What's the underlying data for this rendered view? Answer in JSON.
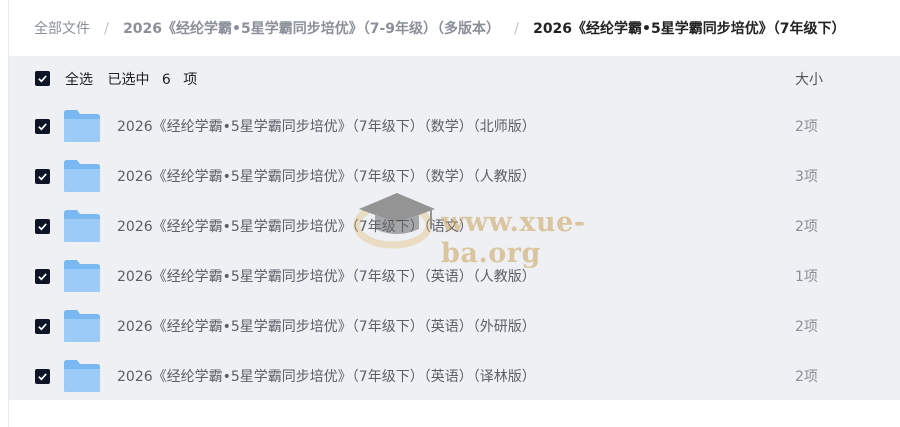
{
  "breadcrumb": {
    "root": "全部文件",
    "parent": "2026《经纶学霸•5星学霸同步培优》（7-9年级）（多版本）",
    "current": "2026《经纶学霸•5星学霸同步培优》（7年级下）"
  },
  "list": {
    "select_all_label": "全选",
    "selected_prefix": "已选中",
    "selected_count": "6",
    "selected_suffix": "项",
    "size_header": "大小",
    "items": [
      {
        "name": "2026《经纶学霸•5星学霸同步培优》（7年级下）（数学）（北师版）",
        "count": "2项"
      },
      {
        "name": "2026《经纶学霸•5星学霸同步培优》（7年级下）（数学）（人教版）",
        "count": "3项"
      },
      {
        "name": "2026《经纶学霸•5星学霸同步培优》（7年级下）（语文）",
        "count": "2项"
      },
      {
        "name": "2026《经纶学霸•5星学霸同步培优》（7年级下）（英语）（人教版）",
        "count": "1项"
      },
      {
        "name": "2026《经纶学霸•5星学霸同步培优》（7年级下）（英语）（外研版）",
        "count": "2项"
      },
      {
        "name": "2026《经纶学霸•5星学霸同步培优》（7年级下）（英语）（译林版）",
        "count": "2项"
      }
    ]
  },
  "watermark": {
    "text": "www.xue-ba.org"
  },
  "colors": {
    "checkbox": "#0d1426",
    "panel": "#eff0f3",
    "folder": "#6aaef0"
  }
}
